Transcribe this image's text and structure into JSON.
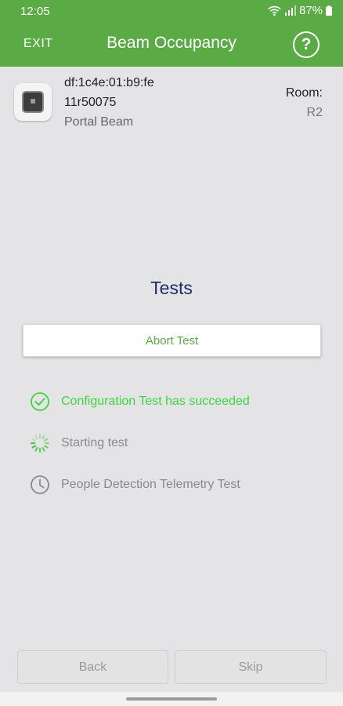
{
  "status_bar": {
    "time": "12:05",
    "battery_text": "87%",
    "icons": [
      "wifi-icon",
      "signal-icon",
      "battery-icon"
    ]
  },
  "app_bar": {
    "exit_label": "EXIT",
    "title": "Beam Occupancy",
    "help_label": "?"
  },
  "device": {
    "mac": "df:1c4e:01:b9:fe",
    "serial": "11r50075",
    "type": "Portal Beam",
    "room_label": "Room:",
    "room_value": "R2",
    "icon": "device-icon"
  },
  "tests": {
    "title": "Tests",
    "abort_label": "Abort Test",
    "items": [
      {
        "label": "Configuration Test has succeeded",
        "status": "succeeded",
        "icon": "check-circle-icon"
      },
      {
        "label": "Starting test",
        "status": "running",
        "icon": "spinner-icon"
      },
      {
        "label": "People Detection Telemetry Test",
        "status": "pending",
        "icon": "clock-icon"
      }
    ]
  },
  "footer": {
    "back_label": "Back",
    "skip_label": "Skip"
  },
  "colors": {
    "brand_green": "#5aab46",
    "success_green": "#3ed43e",
    "title_blue": "#1f2c6b",
    "background": "#e4e4e6"
  }
}
